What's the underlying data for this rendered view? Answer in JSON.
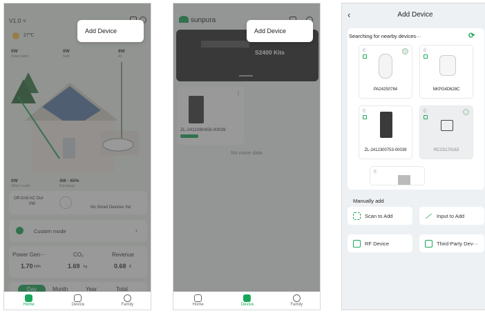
{
  "home_screen": {
    "version": "V1.0 ˅",
    "weather_temp": "27℃",
    "popup_label": "Add Device",
    "stats_top": [
      {
        "value": "0W",
        "label": "Solar panel"
      },
      {
        "value": "0W",
        "label": "Grid"
      },
      {
        "value": "8W",
        "label": "Ac"
      }
    ],
    "stats_bottom": [
      {
        "value": "0W",
        "label": "Other Loads"
      },
      {
        "value": "4W · 65%",
        "label": "Discharge"
      }
    ],
    "offgrid_label": "Off-Grid AC Out",
    "offgrid_value": "0W",
    "smart_devices": "No Smart Devices Yet",
    "mode_label": "Custom mode",
    "power_gen_label": "Power Gen···",
    "power_gen_value": "1.70",
    "power_gen_unit": "kWh",
    "co2_label": "CO₂",
    "co2_value": "1.69",
    "co2_unit": "kg",
    "revenue_label": "Revenue",
    "revenue_value": "0.68",
    "revenue_unit": "$",
    "periods": [
      "Day",
      "Month",
      "Year",
      "Total"
    ],
    "tabs": [
      "Home",
      "Device",
      "Family"
    ]
  },
  "device_screen": {
    "brand": "sunpura",
    "popup_label": "Add Device",
    "banner_text": "S2400 Kits",
    "device_name": "ZL-2411080459-00039",
    "no_more": "No more data",
    "tabs": [
      "Home",
      "Device",
      "Family"
    ]
  },
  "add_device_screen": {
    "title": "Add Device",
    "searching_label": "Searching for nearby devices···",
    "devices": [
      {
        "name": "PA24250784"
      },
      {
        "name": "NKPG4D628C"
      },
      {
        "name": "ZL-2412300753-00039"
      },
      {
        "name": "RCC5170163"
      }
    ],
    "manual_label": "Manually add",
    "manual_buttons": [
      "Scan to Add",
      "Input to Add",
      "RF Device",
      "Third-Party Dev···"
    ]
  },
  "colors": {
    "accent": "#1aa65a",
    "overlay": "rgba(70,70,70,0.55)"
  }
}
